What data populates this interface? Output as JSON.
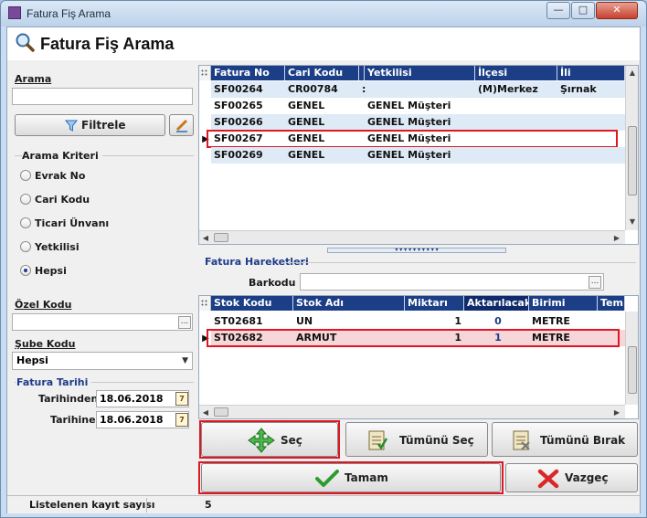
{
  "window": {
    "title": "Fatura Fiş Arama",
    "min": "—",
    "max": "□",
    "close": "✕"
  },
  "header": {
    "title": "Fatura Fiş Arama"
  },
  "left": {
    "arama_label": "Arama",
    "arama_value": "",
    "filtrele_label": "Filtrele",
    "arama_kriteri_label": "Arama Kriteri",
    "radios": [
      "Evrak No",
      "Cari Kodu",
      "Ticari Ünvanı",
      "Yetkilisi",
      "Hepsi"
    ],
    "radio_selected": "Hepsi",
    "ozel_kodu_label": "Özel Kodu",
    "ozel_kodu_value": "",
    "sube_kodu_label": "Şube Kodu",
    "sube_kodu_value": "Hepsi",
    "fatura_tarihi_label": "Fatura Tarihi",
    "tarihinden_label": "Tarihinden",
    "tarihinden_value": "18.06.2018",
    "tarihine_label": "Tarihine",
    "tarihine_value": "18.06.2018"
  },
  "invoices": {
    "columns": [
      "Fatura No",
      "Cari Kodu",
      "",
      "Yetkilisi",
      "İlçesi",
      "İli"
    ],
    "rows": [
      [
        "SF00264",
        "CR00784",
        ":",
        "",
        "(M)Merkez",
        "Şırnak"
      ],
      [
        "SF00265",
        "GENEL",
        "",
        "GENEL Müşteri",
        "",
        ""
      ],
      [
        "SF00266",
        "GENEL",
        "",
        "GENEL Müşteri",
        "",
        ""
      ],
      [
        "SF00267",
        "GENEL",
        "",
        "GENEL Müşteri",
        "",
        ""
      ],
      [
        "SF00269",
        "GENEL",
        "",
        "GENEL Müşteri",
        "",
        ""
      ]
    ],
    "current_row": "SF00267"
  },
  "hareket": {
    "title": "Fatura Hareketleri",
    "barkod_label": "Barkodu",
    "barkod_value": "",
    "columns": [
      "Stok Kodu",
      "Stok Adı",
      "Miktarı",
      "Aktarılacak",
      "Birimi",
      "Tem"
    ],
    "rows": [
      [
        "ST02681",
        "UN",
        "1",
        "0",
        "METRE"
      ],
      [
        "ST02682",
        "ARMUT",
        "1",
        "1",
        "METRE"
      ]
    ],
    "current_row": "ST02682"
  },
  "buttons": {
    "sec": "Seç",
    "tumunu_sec": "Tümünü Seç",
    "tumunu_birak": "Tümünü Bırak",
    "tamam": "Tamam",
    "vazgec": "Vazgeç"
  },
  "status": {
    "label": "Listelenen kayıt sayısı",
    "count": "5"
  },
  "colors": {
    "header_bg": "#1b3e86",
    "highlight": "#e01622",
    "alt_row": "#dfeaf7"
  }
}
